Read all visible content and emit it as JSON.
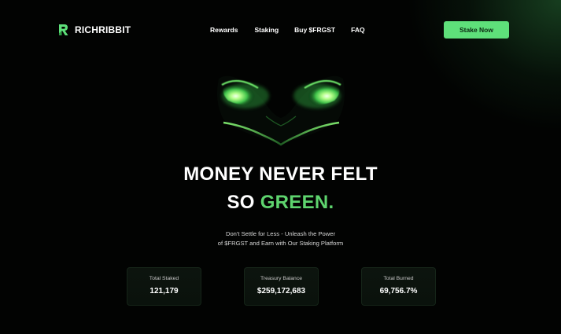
{
  "brand": {
    "name": "RICHRIBBIT",
    "accent_color": "#5ee07a",
    "logo_icon": "r-logo-icon"
  },
  "nav": {
    "items": [
      "Rewards",
      "Staking",
      "Buy $FRGST",
      "FAQ"
    ]
  },
  "cta": {
    "label": "Stake Now"
  },
  "hero": {
    "art_icon": "frog-eyes-icon",
    "headline_line1": "MONEY NEVER FELT",
    "headline_line2_prefix": "SO ",
    "headline_line2_highlight": "GREEN.",
    "sub_line1": "Don't Settle for Less - Unleash the Power",
    "sub_line2": "of $FRGST and Earn with Our Staking Platform"
  },
  "stats": [
    {
      "label": "Total Staked",
      "value": "121,179"
    },
    {
      "label": "Treasury Balance",
      "value": "$259,172,683"
    },
    {
      "label": "Total Burned",
      "value": "69,756.7%"
    }
  ]
}
